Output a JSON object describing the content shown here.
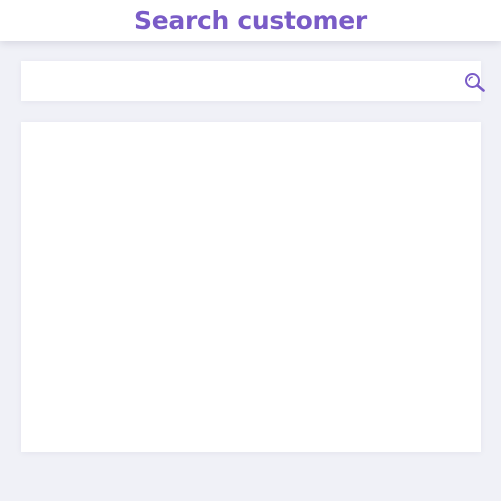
{
  "header": {
    "title": "Search customer"
  },
  "search": {
    "value": "",
    "placeholder": "",
    "icon": "search-icon"
  },
  "colors": {
    "accent": "#7a5cc7",
    "background": "#f0f1f7",
    "panel": "#ffffff"
  }
}
